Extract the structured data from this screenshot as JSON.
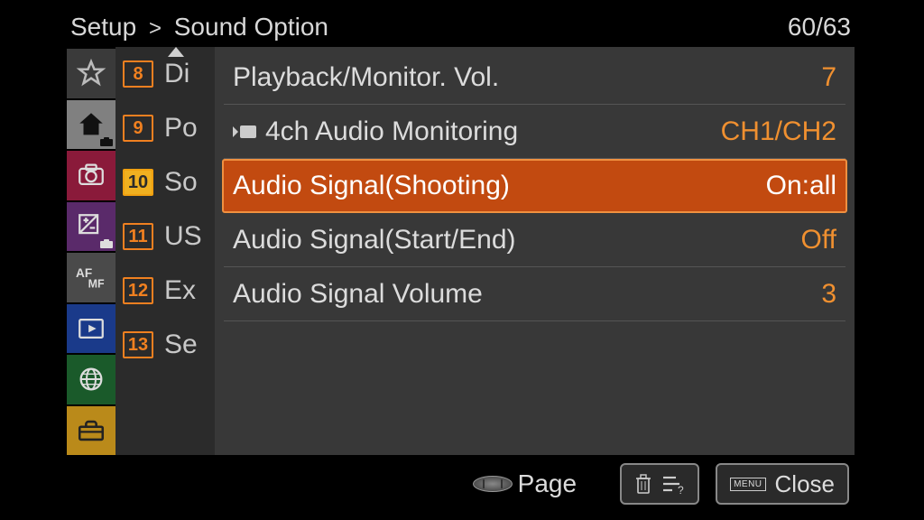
{
  "breadcrumb": {
    "root": "Setup",
    "separator": ">",
    "section": "Sound Option"
  },
  "page_counter": "60/63",
  "tabs": [
    {
      "key": "star",
      "name": "tab-favorite"
    },
    {
      "key": "home",
      "name": "tab-main",
      "active": true
    },
    {
      "key": "camera",
      "name": "tab-shooting"
    },
    {
      "key": "exp",
      "name": "tab-exposure"
    },
    {
      "key": "af",
      "name": "tab-focus"
    },
    {
      "key": "play",
      "name": "tab-playback"
    },
    {
      "key": "globe",
      "name": "tab-network"
    },
    {
      "key": "setup",
      "name": "tab-setup"
    }
  ],
  "behind_rows": [
    {
      "num": "8",
      "peek": "Di"
    },
    {
      "num": "9",
      "peek": "Po"
    },
    {
      "num": "10",
      "peek": "So",
      "active": true
    },
    {
      "num": "11",
      "peek": "US"
    },
    {
      "num": "12",
      "peek": "Ex"
    },
    {
      "num": "13",
      "peek": "Se"
    }
  ],
  "items": [
    {
      "label": "Playback/Monitor. Vol.",
      "value": "7"
    },
    {
      "label": "4ch Audio Monitoring",
      "value": "CH1/CH2",
      "video_icon": true
    },
    {
      "label": "Audio Signal(Shooting)",
      "value": "On:all",
      "selected": true
    },
    {
      "label": "Audio Signal(Start/End)",
      "value": "Off"
    },
    {
      "label": "Audio Signal Volume",
      "value": "3"
    }
  ],
  "footer": {
    "page_label": "Page",
    "help_hint": "?",
    "menu_label": "MENU",
    "close_label": "Close"
  }
}
